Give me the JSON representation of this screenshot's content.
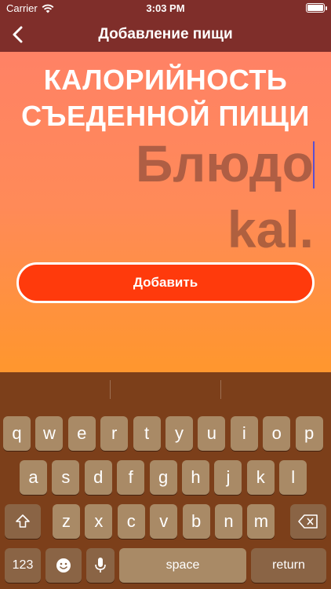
{
  "status_bar": {
    "carrier": "Carrier",
    "time": "3:03 PM",
    "wifi_icon": "wifi-icon",
    "battery_icon": "battery-icon",
    "battery_level": 1.0
  },
  "nav": {
    "title": "Добавление пищи",
    "back_icon": "chevron-left-icon"
  },
  "heading": {
    "line1": "КАЛОРИЙНОСТЬ",
    "line2": "СЪЕДЕННОЙ ПИЩИ"
  },
  "inputs": {
    "dish_placeholder": "Блюдо",
    "kcal_placeholder": "kal."
  },
  "add_button": {
    "label": "Добавить"
  },
  "keyboard": {
    "row1": [
      "q",
      "w",
      "e",
      "r",
      "t",
      "y",
      "u",
      "i",
      "o",
      "p"
    ],
    "row2": [
      "a",
      "s",
      "d",
      "f",
      "g",
      "h",
      "j",
      "k",
      "l"
    ],
    "row3": [
      "z",
      "x",
      "c",
      "v",
      "b",
      "n",
      "m"
    ],
    "numbers_label": "123",
    "space_label": "space",
    "return_label": "return",
    "shift_icon": "shift-icon",
    "delete_icon": "backspace-icon",
    "emoji_icon": "emoji-icon",
    "mic_icon": "microphone-icon"
  },
  "colors": {
    "nav_bg": "#7f2e2a",
    "button_bg": "#ff3a0c",
    "keyboard_bg": "#7c3f1a",
    "key_bg": "#a98a66"
  }
}
